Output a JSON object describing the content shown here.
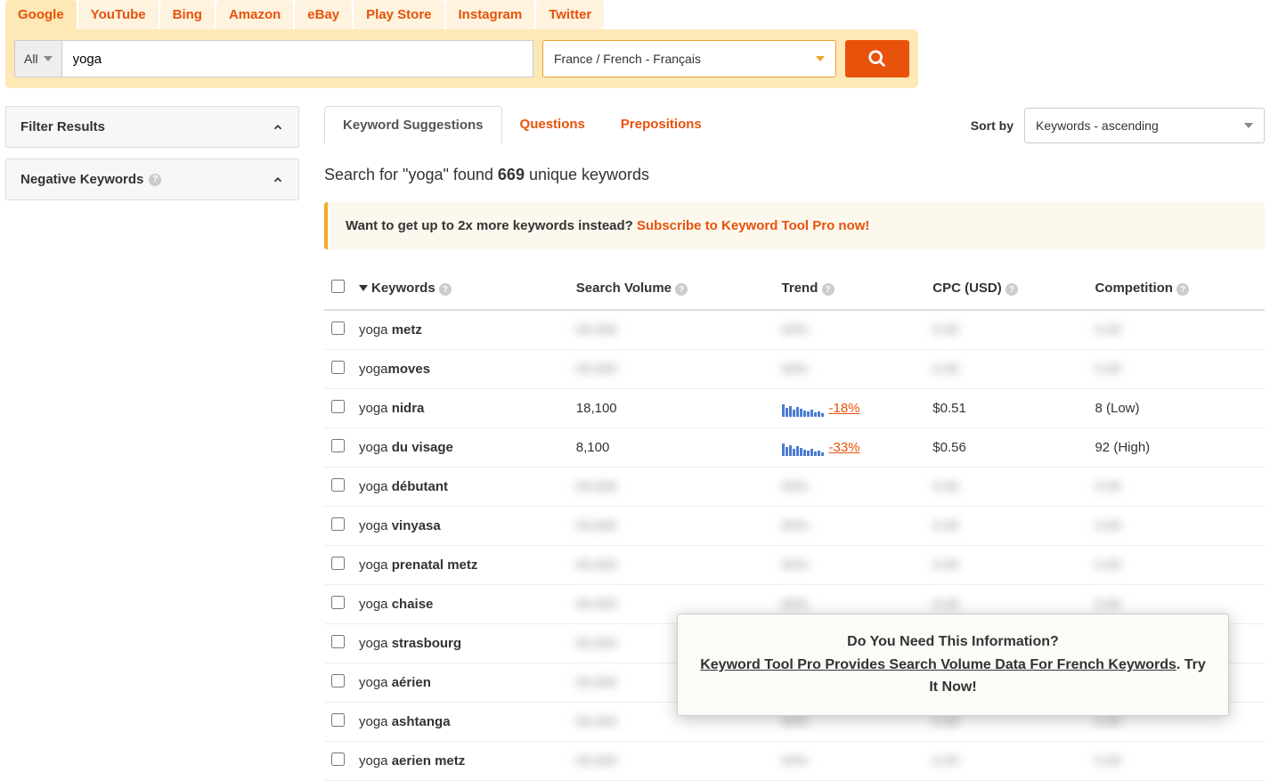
{
  "source_tabs": [
    "Google",
    "YouTube",
    "Bing",
    "Amazon",
    "eBay",
    "Play Store",
    "Instagram",
    "Twitter"
  ],
  "active_source": "Google",
  "search": {
    "scope": "All",
    "query": "yoga",
    "region": "France / French - Français"
  },
  "sidebar": {
    "filter_results": "Filter Results",
    "negative_keywords": "Negative Keywords"
  },
  "result_tabs": {
    "suggestions": "Keyword Suggestions",
    "questions": "Questions",
    "prepositions": "Prepositions"
  },
  "sort": {
    "label": "Sort by",
    "value": "Keywords - ascending"
  },
  "summary": {
    "prefix": "Search for \"",
    "term": "yoga",
    "mid": "\" found ",
    "count": "669",
    "suffix": " unique keywords"
  },
  "promo": {
    "text": "Want to get up to 2x more keywords instead? ",
    "link": "Subscribe to Keyword Tool Pro now!"
  },
  "columns": {
    "keywords": "Keywords",
    "volume": "Search Volume",
    "trend": "Trend",
    "cpc": "CPC (USD)",
    "competition": "Competition"
  },
  "rows": [
    {
      "prefix": "yoga ",
      "suffix": "metz",
      "volume": "",
      "trend": "",
      "cpc": "",
      "comp": "",
      "blurred": true
    },
    {
      "prefix": "yoga",
      "suffix": "moves",
      "volume": "",
      "trend": "",
      "cpc": "",
      "comp": "",
      "blurred": true
    },
    {
      "prefix": "yoga ",
      "suffix": "nidra",
      "volume": "18,100",
      "trend": "-18%",
      "cpc": "$0.51",
      "comp": "8 (Low)",
      "blurred": false
    },
    {
      "prefix": "yoga ",
      "suffix": "du visage",
      "volume": "8,100",
      "trend": "-33%",
      "cpc": "$0.56",
      "comp": "92 (High)",
      "blurred": false
    },
    {
      "prefix": "yoga ",
      "suffix": "débutant",
      "volume": "",
      "trend": "",
      "cpc": "",
      "comp": "",
      "blurred": true
    },
    {
      "prefix": "yoga ",
      "suffix": "vinyasa",
      "volume": "",
      "trend": "",
      "cpc": "",
      "comp": "",
      "blurred": true
    },
    {
      "prefix": "yoga ",
      "suffix": "prenatal metz",
      "volume": "",
      "trend": "",
      "cpc": "",
      "comp": "",
      "blurred": true
    },
    {
      "prefix": "yoga ",
      "suffix": "chaise",
      "volume": "",
      "trend": "",
      "cpc": "",
      "comp": "",
      "blurred": true
    },
    {
      "prefix": "yoga ",
      "suffix": "strasbourg",
      "volume": "",
      "trend": "",
      "cpc": "",
      "comp": "",
      "blurred": true
    },
    {
      "prefix": "yoga ",
      "suffix": "aérien",
      "volume": "",
      "trend": "",
      "cpc": "",
      "comp": "",
      "blurred": true
    },
    {
      "prefix": "yoga ",
      "suffix": "ashtanga",
      "volume": "",
      "trend": "",
      "cpc": "",
      "comp": "",
      "blurred": true
    },
    {
      "prefix": "yoga ",
      "suffix": "aerien metz",
      "volume": "",
      "trend": "",
      "cpc": "",
      "comp": "",
      "blurred": true
    }
  ],
  "popup": {
    "line1": "Do You Need This Information?",
    "line2": "Keyword Tool Pro Provides Search Volume Data For French Keywords",
    "line3_a": ". ",
    "line3_b": "Try It Now!"
  }
}
